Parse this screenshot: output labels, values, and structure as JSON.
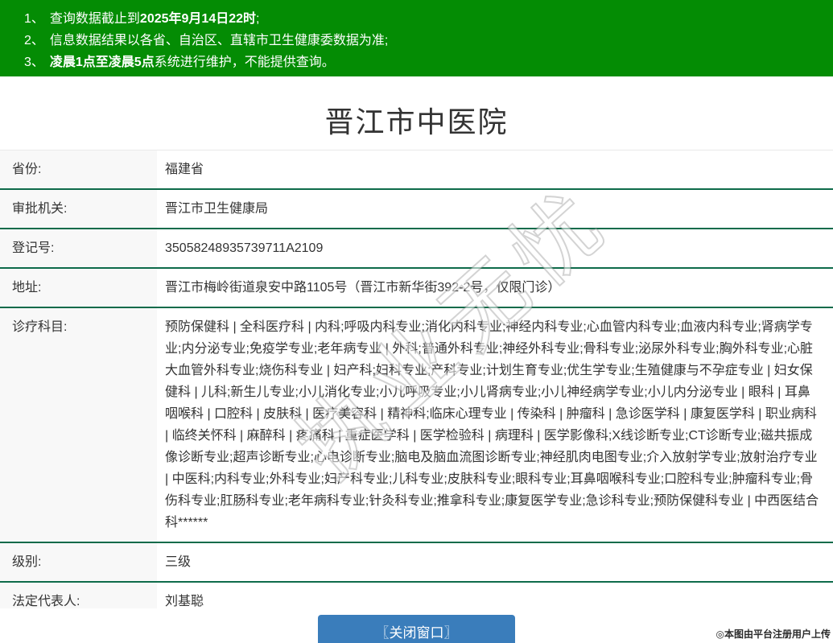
{
  "notices": {
    "items": [
      {
        "num": "1、",
        "pre": "查询数据截止到",
        "bold": "2025年9月14日22时",
        "post": ";"
      },
      {
        "num": "2、",
        "pre": "信息数据结果以各省、自治区、直辖市卫生健康委数据为准;",
        "bold": "",
        "post": ""
      },
      {
        "num": "3、",
        "pre": "",
        "bold": "凌晨1点至凌晨5点",
        "post": "系统进行维护，不能提供查询。"
      }
    ]
  },
  "hospital": {
    "title": "晋江市中医院"
  },
  "table": {
    "rows": [
      {
        "label": "省份:",
        "value": "福建省"
      },
      {
        "label": "审批机关:",
        "value": "晋江市卫生健康局"
      },
      {
        "label": "登记号:",
        "value": "35058248935739711A2109"
      },
      {
        "label": "地址:",
        "value": "晋江市梅岭街道泉安中路1105号（晋江市新华街392-2号，仅限门诊）"
      },
      {
        "label": "诊疗科目:",
        "value": "预防保健科 | 全科医疗科 | 内科;呼吸内科专业;消化内科专业;神经内科专业;心血管内科专业;血液内科专业;肾病学专业;内分泌专业;免疫学专业;老年病专业 | 外科;普通外科专业;神经外科专业;骨科专业;泌尿外科专业;胸外科专业;心脏大血管外科专业;烧伤科专业 | 妇产科;妇科专业;产科专业;计划生育专业;优生学专业;生殖健康与不孕症专业 | 妇女保健科 | 儿科;新生儿专业;小儿消化专业;小儿呼吸专业;小儿肾病专业;小儿神经病学专业;小儿内分泌专业 | 眼科 | 耳鼻咽喉科 | 口腔科 | 皮肤科 | 医疗美容科 | 精神科;临床心理专业 | 传染科 | 肿瘤科 | 急诊医学科 | 康复医学科 | 职业病科 | 临终关怀科 | 麻醉科 | 疼痛科 | 重症医学科 | 医学检验科 | 病理科 | 医学影像科;X线诊断专业;CT诊断专业;磁共振成像诊断专业;超声诊断专业;心电诊断专业;脑电及脑血流图诊断专业;神经肌肉电图专业;介入放射学专业;放射治疗专业 | 中医科;内科专业;外科专业;妇产科专业;儿科专业;皮肤科专业;眼科专业;耳鼻咽喉科专业;口腔科专业;肿瘤科专业;骨伤科专业;肛肠科专业;老年病科专业;针灸科专业;推拿科专业;康复医学专业;急诊科专业;预防保健科专业 | 中西医结合科******"
      },
      {
        "label": "级别:",
        "value": "三级"
      },
      {
        "label": "法定代表人:",
        "value": "刘基聪"
      }
    ]
  },
  "footer": {
    "close_button": "〖关闭窗口〗",
    "credit": "◎本图由平台注册用户上传"
  },
  "watermark": "执业无忧",
  "colors": {
    "banner": "#048c04",
    "notice_text": "#ffffff",
    "row_border": "#0e6b4a",
    "label_bg": "#f8f8f8",
    "button": "#3a7dbb",
    "text": "#333333"
  }
}
